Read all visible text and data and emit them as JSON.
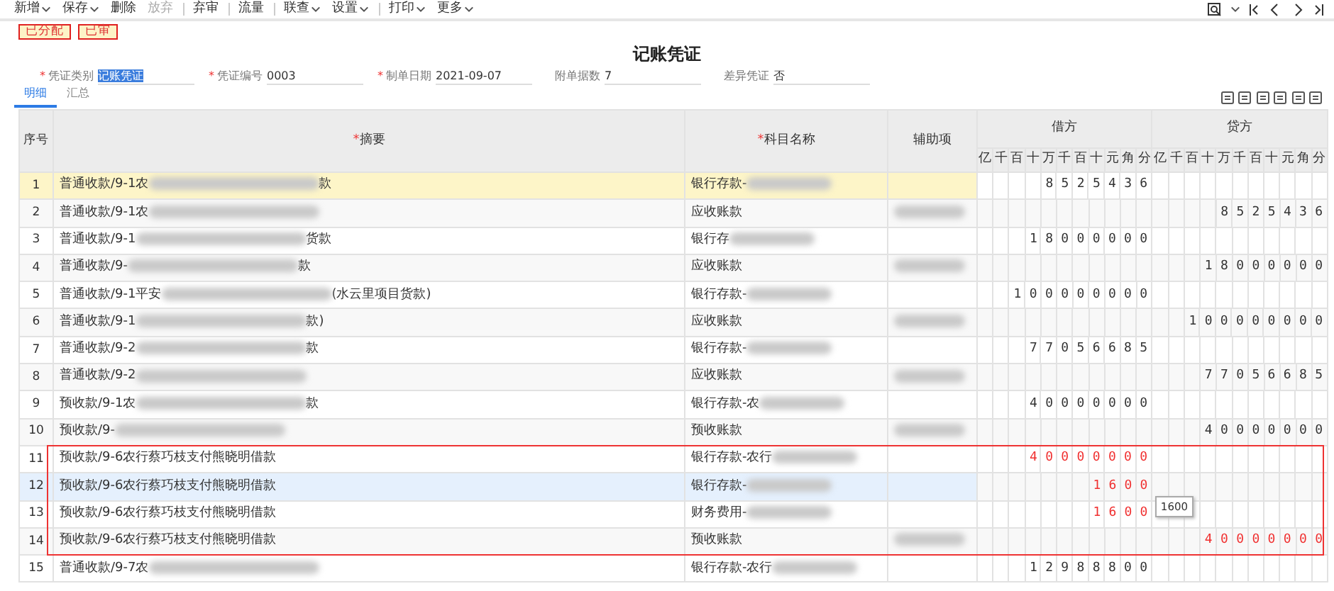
{
  "toolbar": [
    {
      "label": "新增",
      "dropdown": true,
      "disabled": false,
      "separator_before": false
    },
    {
      "label": "保存",
      "dropdown": true,
      "disabled": false,
      "separator_before": false
    },
    {
      "label": "删除",
      "dropdown": false,
      "disabled": false,
      "separator_before": false
    },
    {
      "label": "放弃",
      "dropdown": false,
      "disabled": true,
      "separator_before": false
    },
    {
      "label": "弃审",
      "dropdown": false,
      "disabled": false,
      "separator_before": true
    },
    {
      "label": "流量",
      "dropdown": false,
      "disabled": false,
      "separator_before": true
    },
    {
      "label": "联查",
      "dropdown": true,
      "disabled": false,
      "separator_before": true
    },
    {
      "label": "设置",
      "dropdown": true,
      "disabled": false,
      "separator_before": false
    },
    {
      "label": "打印",
      "dropdown": true,
      "disabled": false,
      "separator_before": true
    },
    {
      "label": "更多",
      "dropdown": true,
      "disabled": false,
      "separator_before": false
    }
  ],
  "status_tags": [
    "已分配",
    "已审"
  ],
  "title": "记账凭证",
  "fields": [
    {
      "marker": "*",
      "label": "凭证类别",
      "value": "记账凭证",
      "selected": true
    },
    {
      "marker": "*",
      "label": "凭证编号",
      "value": "0003",
      "selected": false
    },
    {
      "marker": "*",
      "label": "制单日期",
      "value": "2021-09-07",
      "selected": false
    },
    {
      "label": "附单据数",
      "value": "7",
      "selected": false
    },
    {
      "label": "差异凭证",
      "value": "否",
      "selected": false
    }
  ],
  "tabs": [
    {
      "label": "明细",
      "selected": true
    },
    {
      "label": "汇总",
      "selected": false
    }
  ],
  "table": {
    "columns": [
      {
        "label": "序号"
      },
      {
        "marker": "*",
        "label": "摘要"
      },
      {
        "marker": "*",
        "label": "科目名称"
      },
      {
        "label": "辅助项"
      }
    ],
    "debit_label": "借方",
    "credit_label": "贷方",
    "debit_units": [
      "亿",
      "千",
      "百",
      "十",
      "万",
      "千",
      "百",
      "十",
      "元",
      "角",
      "分"
    ],
    "credit_units": [
      "亿",
      "千",
      "百",
      "十",
      "万",
      "千",
      "百",
      "十",
      "元",
      "角",
      "分"
    ],
    "rows": [
      {
        "seq": "1",
        "summary": "普通收款/9-1农",
        "summary_redacted": true,
        "summary_tail": "款",
        "subject": "银行存款-",
        "subject_redacted": true,
        "aux_redacted": false,
        "debit": "8 5 2 5 4 3 6",
        "selected": true,
        "highlighted": false,
        "flagged": false
      },
      {
        "seq": "2",
        "summary": "普通收款/9-1农",
        "summary_redacted": true,
        "subject": "应收账款",
        "subject_redacted": false,
        "aux_redacted": true,
        "credit": "8 5 2 5 4 3 6",
        "selected": false,
        "highlighted": false,
        "flagged": false
      },
      {
        "seq": "3",
        "summary": "普通收款/9-1",
        "summary_redacted": true,
        "summary_tail": "货款",
        "subject": "银行存",
        "subject_redacted": true,
        "aux_redacted": false,
        "debit": "1 8 0 0 0 0 0 0",
        "selected": false,
        "highlighted": false,
        "flagged": false
      },
      {
        "seq": "4",
        "summary": "普通收款/9-",
        "summary_redacted": true,
        "summary_tail": "款",
        "subject": "应收账款",
        "subject_redacted": false,
        "aux_redacted": true,
        "credit": "1 8 0 0 0 0 0 0",
        "selected": false,
        "highlighted": false,
        "flagged": false
      },
      {
        "seq": "5",
        "summary": "普通收款/9-1平安",
        "summary_redacted": true,
        "summary_tail": "(水云里项目货款)",
        "subject": "银行存款-",
        "subject_redacted": true,
        "aux_redacted": false,
        "debit": "1 0 0 0 0 0 0 0 0",
        "selected": false,
        "highlighted": false,
        "flagged": false
      },
      {
        "seq": "6",
        "summary": "普通收款/9-1",
        "summary_redacted": true,
        "summary_tail": "款)",
        "subject": "应收账款",
        "subject_redacted": false,
        "aux_redacted": true,
        "credit": "1 0 0 0 0 0 0 0 0",
        "selected": false,
        "highlighted": false,
        "flagged": false
      },
      {
        "seq": "7",
        "summary": "普通收款/9-2",
        "summary_redacted": true,
        "summary_tail": "款",
        "subject": "银行存款-",
        "subject_redacted": true,
        "aux_redacted": false,
        "debit": "7 7 0 5 6 6 8 5",
        "selected": false,
        "highlighted": false,
        "flagged": false
      },
      {
        "seq": "8",
        "summary": "普通收款/9-2",
        "summary_redacted": true,
        "subject": "应收账款",
        "subject_redacted": false,
        "aux_redacted": true,
        "credit": "7 7 0 5 6 6 8 5",
        "selected": false,
        "highlighted": false,
        "flagged": false
      },
      {
        "seq": "9",
        "summary": "预收款/9-1农",
        "summary_redacted": true,
        "summary_tail": "款",
        "subject": "银行存款-农",
        "subject_redacted": true,
        "aux_redacted": false,
        "debit": "4 0 0 0 0 0 0 0",
        "selected": false,
        "highlighted": false,
        "flagged": false
      },
      {
        "seq": "10",
        "summary": "预收款/9-",
        "summary_redacted": true,
        "subject": "预收账款",
        "subject_redacted": false,
        "aux_redacted": true,
        "credit": "4 0 0 0 0 0 0 0",
        "selected": false,
        "highlighted": false,
        "flagged": false
      },
      {
        "seq": "11",
        "summary": "预收款/9-6农行蔡巧枝支付熊晓明借款",
        "summary_redacted": false,
        "subject": "银行存款-农行",
        "subject_redacted": true,
        "aux_redacted": false,
        "debit": "4 0 0 0 0 0 0 0",
        "selected": false,
        "highlighted": false,
        "flagged": true
      },
      {
        "seq": "12",
        "summary": "预收款/9-6农行蔡巧枝支付熊晓明借款",
        "summary_redacted": false,
        "subject": "银行存款-",
        "subject_redacted": true,
        "aux_redacted": false,
        "debit": "1 6 0 0",
        "tooltip": "1600",
        "selected": false,
        "highlighted": true,
        "flagged": true
      },
      {
        "seq": "13",
        "summary": "预收款/9-6农行蔡巧枝支付熊晓明借款",
        "summary_redacted": false,
        "subject": "财务费用-",
        "subject_redacted": true,
        "aux_redacted": false,
        "debit": "1 6 0 0",
        "selected": false,
        "highlighted": false,
        "flagged": true
      },
      {
        "seq": "14",
        "summary": "预收款/9-6农行蔡巧枝支付熊晓明借款",
        "summary_redacted": false,
        "subject": "预收账款",
        "subject_redacted": false,
        "aux_redacted": true,
        "credit": "4 0 0 0 0 0 0 0",
        "selected": false,
        "highlighted": false,
        "flagged": true
      },
      {
        "seq": "15",
        "summary": "普通收款/9-7农",
        "summary_redacted": true,
        "subject": "银行存款-农行",
        "subject_redacted": true,
        "aux_redacted": false,
        "debit": "1 2 9 8 8 8 0 0",
        "selected": false,
        "highlighted": false,
        "flagged": false
      }
    ]
  }
}
